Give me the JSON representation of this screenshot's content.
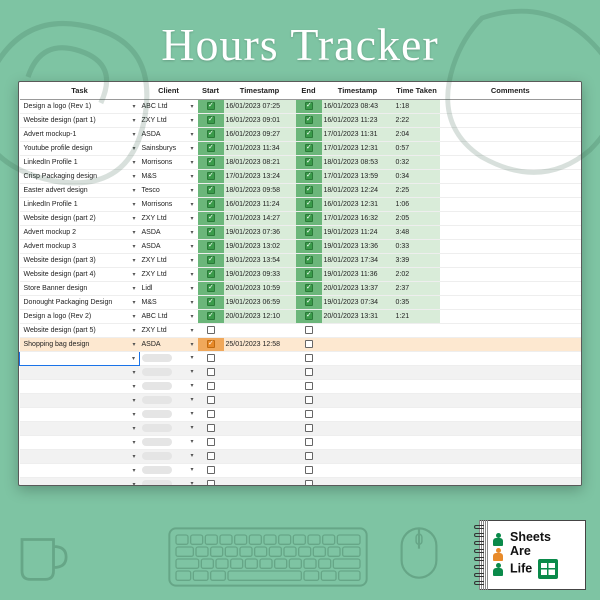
{
  "title": "Hours Tracker",
  "columns": [
    "Task",
    "Client",
    "Start",
    "Timestamp",
    "End",
    "Timestamp",
    "Time Taken",
    "Comments"
  ],
  "rows": [
    {
      "task": "Design a logo (Rev 1)",
      "client": "ABC Ltd",
      "start": true,
      "ts1": "16/01/2023 07:25",
      "end": true,
      "ts2": "16/01/2023 08:43",
      "tt": "1:18",
      "c": ""
    },
    {
      "task": "Website design (part 1)",
      "client": "ZXY Ltd",
      "start": true,
      "ts1": "16/01/2023 09:01",
      "end": true,
      "ts2": "16/01/2023 11:23",
      "tt": "2:22",
      "c": ""
    },
    {
      "task": "Advert mockup-1",
      "client": "ASDA",
      "start": true,
      "ts1": "16/01/2023 09:27",
      "end": true,
      "ts2": "17/01/2023 11:31",
      "tt": "2:04",
      "c": ""
    },
    {
      "task": "Youtube profile design",
      "client": "Sainsburys",
      "start": true,
      "ts1": "17/01/2023 11:34",
      "end": true,
      "ts2": "17/01/2023 12:31",
      "tt": "0:57",
      "c": ""
    },
    {
      "task": "LinkedIn Profile 1",
      "client": "Morrisons",
      "start": true,
      "ts1": "18/01/2023 08:21",
      "end": true,
      "ts2": "18/01/2023 08:53",
      "tt": "0:32",
      "c": ""
    },
    {
      "task": "Crisp Packaging design",
      "client": "M&S",
      "start": true,
      "ts1": "17/01/2023 13:24",
      "end": true,
      "ts2": "17/01/2023 13:59",
      "tt": "0:34",
      "c": ""
    },
    {
      "task": "Easter advert design",
      "client": "Tesco",
      "start": true,
      "ts1": "18/01/2023 09:58",
      "end": true,
      "ts2": "18/01/2023 12:24",
      "tt": "2:25",
      "c": ""
    },
    {
      "task": "LinkedIn Profile 1",
      "client": "Morrisons",
      "start": true,
      "ts1": "16/01/2023 11:24",
      "end": true,
      "ts2": "16/01/2023 12:31",
      "tt": "1:06",
      "c": ""
    },
    {
      "task": "Website design (part 2)",
      "client": "ZXY Ltd",
      "start": true,
      "ts1": "17/01/2023 14:27",
      "end": true,
      "ts2": "17/01/2023 16:32",
      "tt": "2:05",
      "c": ""
    },
    {
      "task": "Advert mockup 2",
      "client": "ASDA",
      "start": true,
      "ts1": "19/01/2023 07:36",
      "end": true,
      "ts2": "19/01/2023 11:24",
      "tt": "3:48",
      "c": ""
    },
    {
      "task": "Advert mockup 3",
      "client": "ASDA",
      "start": true,
      "ts1": "19/01/2023 13:02",
      "end": true,
      "ts2": "19/01/2023 13:36",
      "tt": "0:33",
      "c": ""
    },
    {
      "task": "Website design (part 3)",
      "client": "ZXY Ltd",
      "start": true,
      "ts1": "18/01/2023 13:54",
      "end": true,
      "ts2": "18/01/2023 17:34",
      "tt": "3:39",
      "c": ""
    },
    {
      "task": "Website design (part 4)",
      "client": "ZXY Ltd",
      "start": true,
      "ts1": "19/01/2023 09:33",
      "end": true,
      "ts2": "19/01/2023 11:36",
      "tt": "2:02",
      "c": ""
    },
    {
      "task": "Store Banner design",
      "client": "Lidl",
      "start": true,
      "ts1": "20/01/2023 10:59",
      "end": true,
      "ts2": "20/01/2023 13:37",
      "tt": "2:37",
      "c": ""
    },
    {
      "task": "Donought Packaging Design",
      "client": "M&S",
      "start": true,
      "ts1": "19/01/2023 06:59",
      "end": true,
      "ts2": "19/01/2023 07:34",
      "tt": "0:35",
      "c": ""
    },
    {
      "task": "Design a logo (Rev 2)",
      "client": "ABC Ltd",
      "start": true,
      "ts1": "20/01/2023 12:10",
      "end": true,
      "ts2": "20/01/2023 13:31",
      "tt": "1:21",
      "c": ""
    },
    {
      "task": "Website design (part 5)",
      "client": "ZXY Ltd",
      "start": false,
      "ts1": "",
      "end": false,
      "ts2": "",
      "tt": "",
      "c": "",
      "state": "pending"
    },
    {
      "task": "Shopping bag design",
      "client": "ASDA",
      "start": true,
      "ts1": "25/01/2023 12:58",
      "end": false,
      "ts2": "",
      "tt": "",
      "c": "",
      "state": "active"
    }
  ],
  "empty_rows": 16,
  "logo": {
    "line1": "Sheets",
    "line2": "Are",
    "line3": "Life"
  }
}
